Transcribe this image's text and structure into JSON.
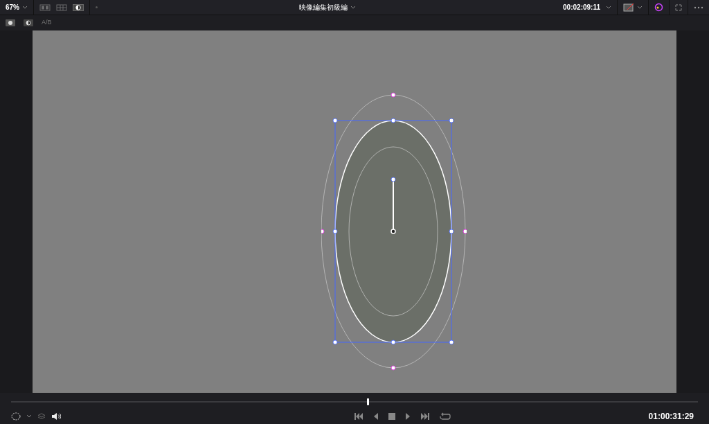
{
  "top_bar": {
    "zoom": "67%",
    "view_buttons": [
      {
        "kind": "split",
        "selected": false
      },
      {
        "kind": "grid",
        "selected": false
      },
      {
        "kind": "compare",
        "selected": true
      }
    ],
    "title": "映像編集初級編",
    "timecode": "00:02:09:11"
  },
  "sub_bar": {
    "ab_label": "A/B"
  },
  "transport": {
    "scrubber": {
      "level": 0.518
    },
    "timecode": "01:00:31:29"
  }
}
